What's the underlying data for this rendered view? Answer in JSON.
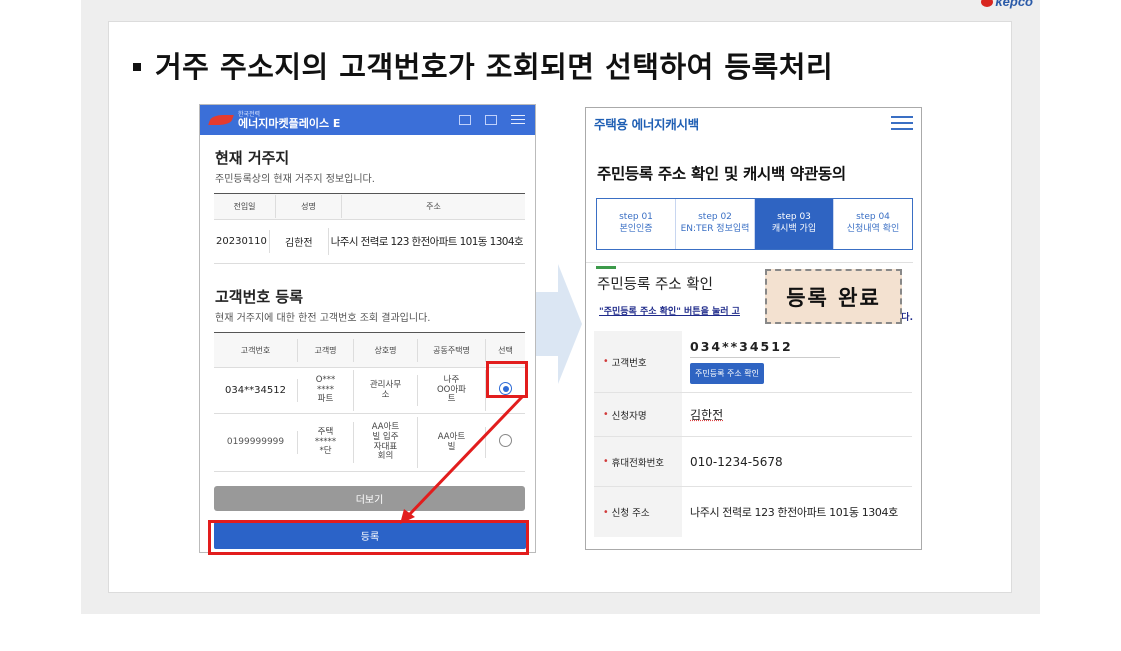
{
  "brand": {
    "logo_text": "kepco"
  },
  "slide": {
    "title": "거주 주소지의 고객번호가 조회되면 선택하여 등록처리"
  },
  "left_phone": {
    "header": {
      "logo_small": "한국전력",
      "logo_text": "에너지마켓플레이스 E"
    },
    "residence": {
      "title": "현재 거주지",
      "desc": "주민등록상의 현재 거주지 정보입니다.",
      "columns": [
        "전입일",
        "성명",
        "주소"
      ],
      "row": {
        "date": "20230110",
        "name": "김한전",
        "address": "나주시 전력로 123 한전아파트 101동 1304호"
      }
    },
    "customer": {
      "title": "고객번호 등록",
      "desc": "현재 거주지에 대한 한전 고객번호 조회 결과입니다.",
      "columns": [
        "고객번호",
        "고객명",
        "상호명",
        "공동주택명",
        "선택"
      ],
      "rows": [
        {
          "number": "034**34512",
          "name": "O***\n****\n파트",
          "company": "관리사무\n소",
          "apt": "나주\nOO아파\n트",
          "selected": true
        },
        {
          "number": "0199999999",
          "name": "주택\n*****\n*단",
          "company": "AA아트\n빌 입주\n자대표\n회의",
          "apt": "AA아트\n빌",
          "selected": false
        }
      ]
    },
    "more_label": "더보기",
    "register_label": "등록"
  },
  "right_phone": {
    "brand": "주택용 에너지캐시백",
    "title": "주민등록 주소 확인 및 캐시백 약관동의",
    "steps": [
      {
        "num": "step 01",
        "label": "본인인증",
        "active": false
      },
      {
        "num": "step 02",
        "label": "EN:TER 정보입력",
        "active": false
      },
      {
        "num": "step 03",
        "label": "캐시백 가입",
        "active": true
      },
      {
        "num": "step 04",
        "label": "신청내역 확인",
        "active": false
      }
    ],
    "section_title": "주민등록 주소 확인",
    "notice": "\"주민등록 주소 확인\" 버튼을 눌러 고",
    "notice_end": "다.",
    "form": {
      "customer_no_label": "고객번호",
      "customer_no_value": "034**34512",
      "verify_button": "주민등록 주소 확인",
      "applicant_label": "신청자명",
      "applicant_value": "김한전",
      "phone_label": "휴대전화번호",
      "phone_value": "010-1234-5678",
      "address_label": "신청 주소",
      "address_value": "나주시 전력로 123 한전아파트 101동 1304호"
    }
  },
  "done_badge": "등록 완료",
  "colors": {
    "accent": "#2f64c2",
    "highlight": "#e21d1d",
    "badge_bg": "#f3e1d0"
  }
}
